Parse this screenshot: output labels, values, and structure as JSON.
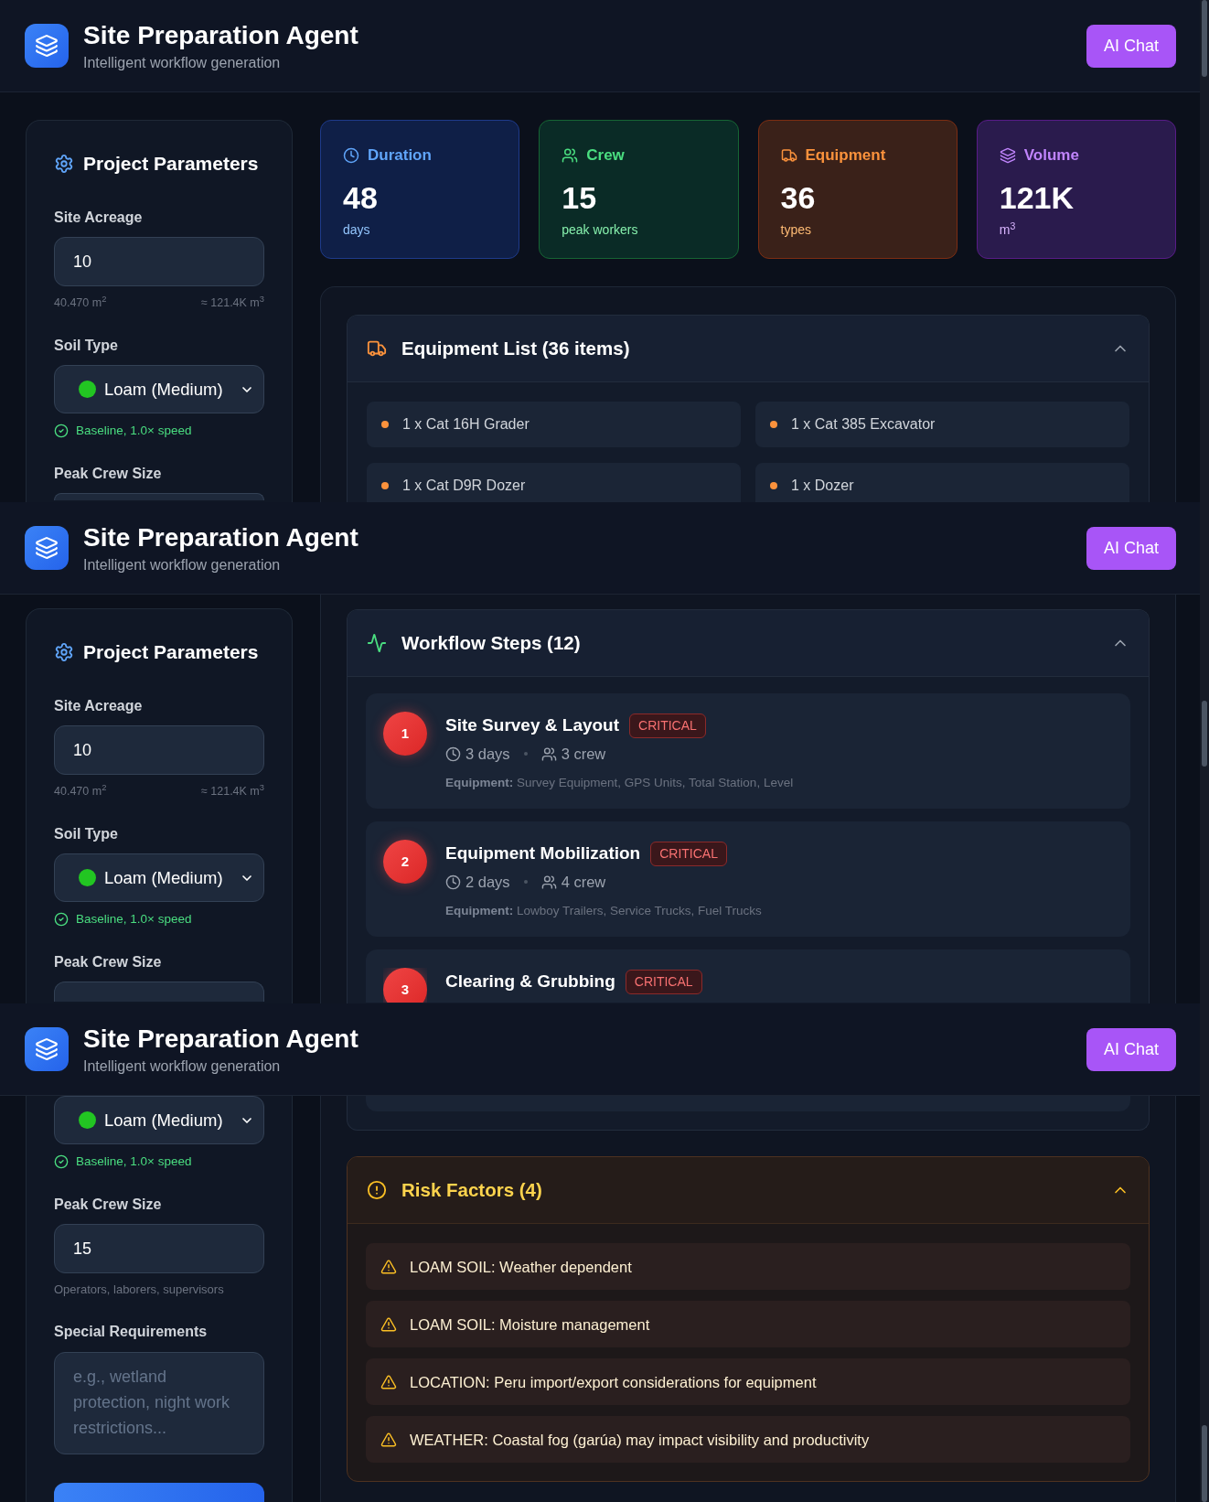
{
  "captures": [
    {
      "header": {
        "title": "Site Preparation Agent",
        "subtitle": "Intelligent workflow generation",
        "chat_button": "AI Chat"
      },
      "parameters_panel": {
        "title": "Project Parameters",
        "fields": [
          {
            "kind": "number",
            "label": "Site Acreage",
            "value": "10",
            "hints": [
              "40.470 m$^{2}$",
              "≈ 121.4K m$^{3}$"
            ]
          },
          {
            "kind": "select",
            "label": "Soil Type",
            "value": "Loam (Medium)",
            "note": "Baseline, 1.0× speed"
          },
          {
            "kind": "number",
            "label": "Peak Crew Size"
          }
        ]
      },
      "stats": [
        {
          "kind": "duration",
          "label": "Duration",
          "value": "48",
          "unit": "days"
        },
        {
          "kind": "crew",
          "label": "Crew",
          "value": "15",
          "unit": "peak workers"
        },
        {
          "kind": "equipment",
          "label": "Equipment",
          "value": "36",
          "unit": "types"
        },
        {
          "kind": "volume",
          "label": "Volume",
          "value": "121K",
          "unit": "m$^{3}$"
        }
      ],
      "equipment_list": {
        "title": "Equipment List (36 items)",
        "expanded": true,
        "items": [
          "1 x Cat 16H Grader",
          "1 x Cat 385 Excavator",
          "1 x Cat D9R Dozer",
          "1 x Dozer"
        ]
      }
    },
    {
      "header": {
        "title": "Site Preparation Agent",
        "subtitle": "Intelligent workflow generation",
        "chat_button": "AI Chat"
      },
      "parameters_panel": {
        "title": "Project Parameters",
        "fields": [
          {
            "kind": "number",
            "label": "Site Acreage",
            "value": "10",
            "hints": [
              "40.470 m$^{2}$",
              "≈ 121.4K m$^{3}$"
            ]
          },
          {
            "kind": "select",
            "label": "Soil Type",
            "value": "Loam (Medium)",
            "note": "Baseline, 1.0× speed"
          },
          {
            "kind": "number",
            "label": "Peak Crew Size"
          }
        ]
      },
      "workflow_steps": {
        "title": "Workflow Steps (12)",
        "expanded": true,
        "steps": [
          {
            "number": "1",
            "title": "Site Survey & Layout",
            "badge": "CRITICAL",
            "duration": "3 days",
            "crew": "3 crew",
            "equipment": "**Equipment:** Survey Equipment, GPS Units, Total Station, Level"
          },
          {
            "number": "2",
            "title": "Equipment Mobilization",
            "badge": "CRITICAL",
            "duration": "2 days",
            "crew": "4 crew",
            "equipment": "**Equipment:** Lowboy Trailers, Service Trucks, Fuel Trucks"
          },
          {
            "number": "3",
            "title": "Clearing & Grubbing",
            "badge": "CRITICAL"
          }
        ]
      }
    },
    {
      "header": {
        "title": "Site Preparation Agent",
        "subtitle": "Intelligent workflow generation",
        "chat_button": "AI Chat"
      },
      "parameters_panel": {
        "fields": [
          {
            "kind": "select",
            "value": "Loam (Medium)",
            "note": "Baseline, 1.0× speed"
          },
          {
            "kind": "number",
            "label": "Peak Crew Size",
            "value": "15",
            "hint": "Operators, laborers, supervisors"
          },
          {
            "kind": "textarea",
            "label": "Special Requirements",
            "placeholder": "e.g., wetland protection, night work restrictions..."
          },
          {
            "kind": "button"
          }
        ]
      },
      "risk_factors": {
        "title": "Risk Factors (4)",
        "expanded": true,
        "items": [
          "LOAM SOIL: Weather dependent",
          "LOAM SOIL: Moisture management",
          "LOCATION: Peru import/export considerations for equipment",
          "WEATHER: Coastal fog (garúa) may impact visibility and productivity"
        ]
      }
    }
  ]
}
